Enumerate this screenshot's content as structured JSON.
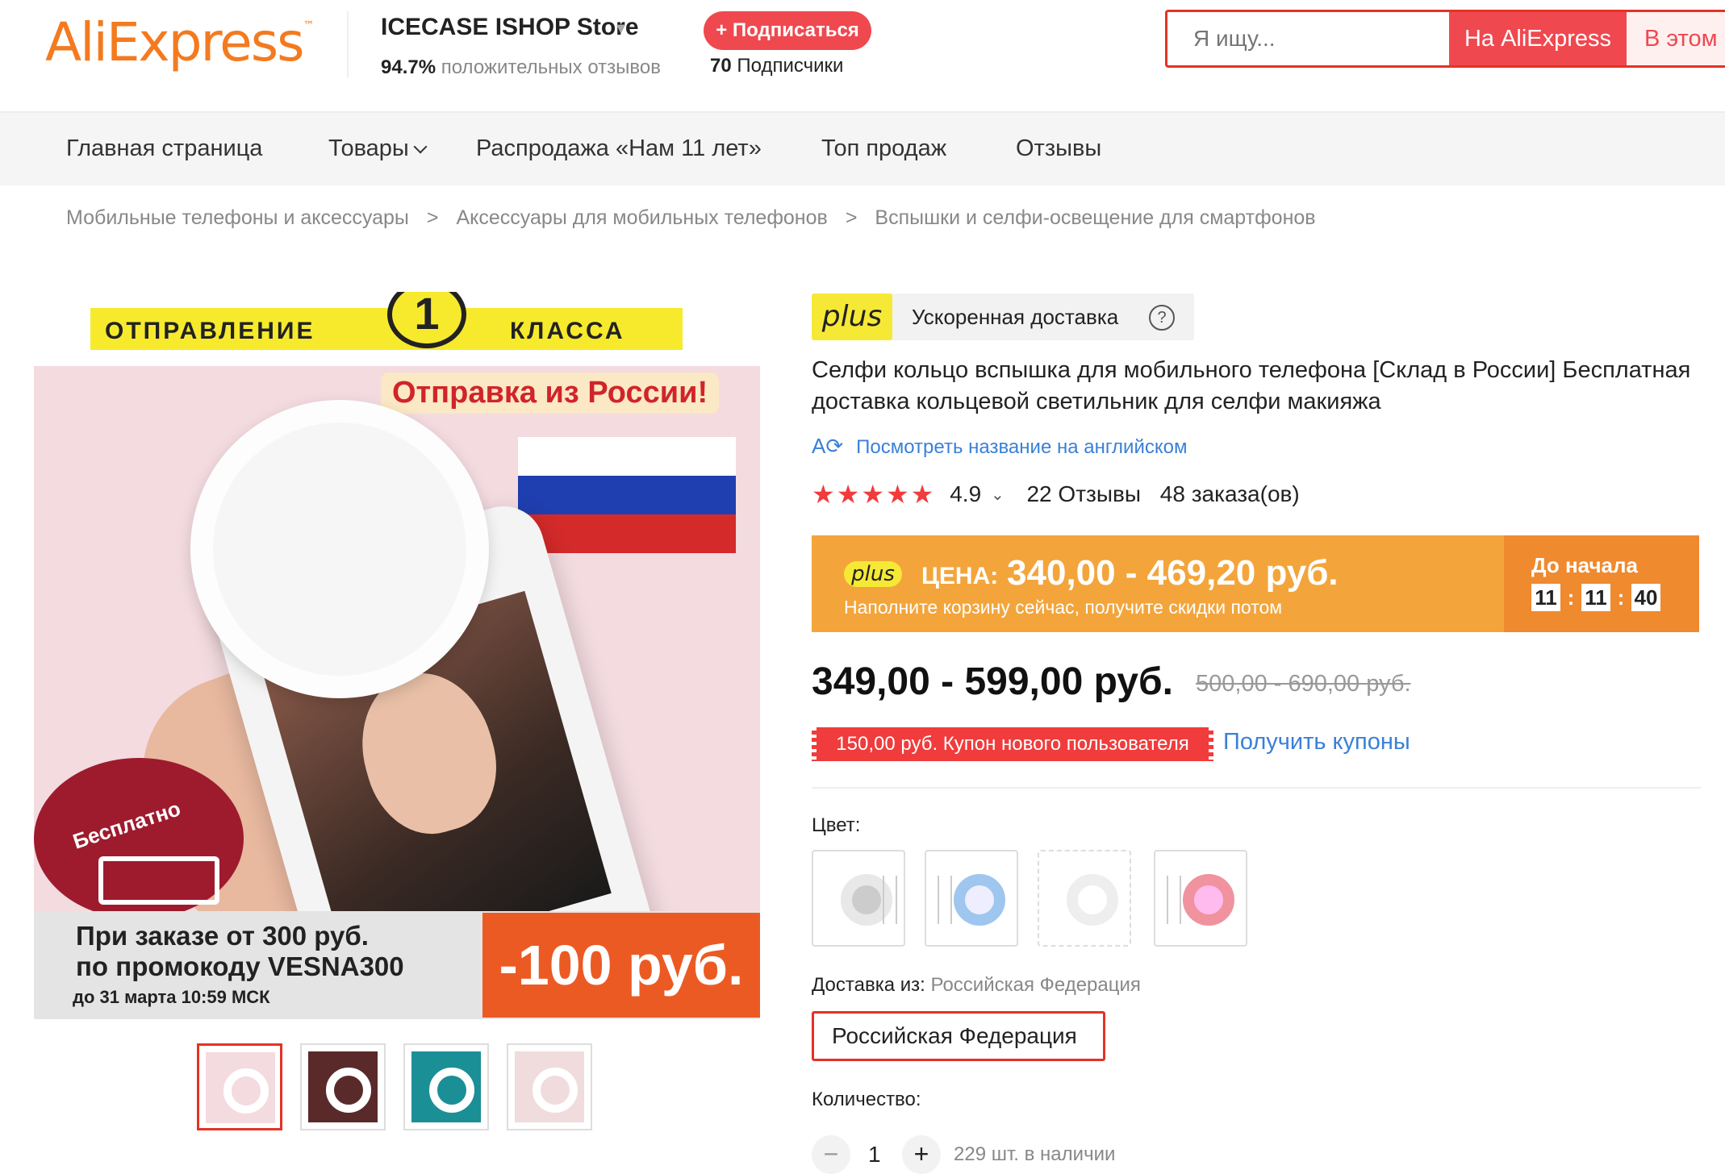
{
  "header": {
    "logo": "AliExpress",
    "logo_tm": "™",
    "store_name": "ICECASE ISHOP Store",
    "store_caret": "▾",
    "positive_reviews_value": "94.7%",
    "positive_reviews_text": "положительных отзывов",
    "subscribe_label": "+ Подписаться",
    "followers_count": "70",
    "followers_label": "Подписчики",
    "search_placeholder": "Я ищу...",
    "search_ali_label": "На AliExpress",
    "search_store_label": "В этом м"
  },
  "nav": {
    "items": [
      "Главная страница",
      "Товары",
      "Распродажа «Нам 11 лет»",
      "Топ продаж",
      "Отзывы"
    ]
  },
  "breadcrumb": {
    "items": [
      "Мобильные телефоны и аксессуары",
      "Аксессуары для мобильных телефонов",
      "Вспышки и селфи-освещение для смартфонов"
    ],
    "separator": ">"
  },
  "image": {
    "badge_left": "ОТПРАВЛЕНИЕ",
    "badge_num": "1",
    "badge_right": "КЛАССА",
    "from_russia": "Отправка из России!",
    "free": "Бесплатно",
    "promo_line1": "При заказе от  300 руб.",
    "promo_line2": "по промокоду VESNA300",
    "promo_line3": "до 31 марта 10:59 МСК",
    "promo_discount": "-100 руб."
  },
  "plus": {
    "logo": "plus",
    "text": "Ускоренная доставка",
    "help": "?"
  },
  "product": {
    "title": "Селфи кольцо вспышка для мобильного телефона [Склад в России] Бесплатная доставка кольцевой светильник для селфи макияжа",
    "translate_icon": "A̲͡",
    "translate_link": "Посмотреть название на английском",
    "stars": "★★★★★",
    "rating": "4.9",
    "rating_caret": "⌄",
    "reviews": "22 Отзывы",
    "orders": "48 заказа(ов)"
  },
  "price_banner": {
    "plus_logo": "plus",
    "label": "ЦЕНА:",
    "price": "340,00 - 469,20 руб.",
    "subtext": "Наполните корзину сейчас, получите скидки потом",
    "until": "До начала",
    "timer": [
      "11",
      "11",
      "40"
    ],
    "colon": ":"
  },
  "price": {
    "current": "349,00 - 599,00 руб.",
    "old": "500,00 - 690,00 руб."
  },
  "coupon": {
    "label": "150,00 руб. Купон нового пользователя",
    "get": "Получить купоны"
  },
  "options": {
    "color_label": "Цвет:",
    "ship_from_label": "Доставка из:",
    "ship_from_value": "Российская Федерация",
    "ship_selected": "Российская Федерация",
    "qty_label": "Количество:",
    "qty_minus": "−",
    "qty_value": "1",
    "qty_plus": "+",
    "qty_stock": "229 шт. в наличии"
  },
  "colors": {
    "accent": "#e43225",
    "price_banner": "#f3a53b",
    "link": "#3a80d7",
    "plus_yellow": "#f6e936"
  }
}
